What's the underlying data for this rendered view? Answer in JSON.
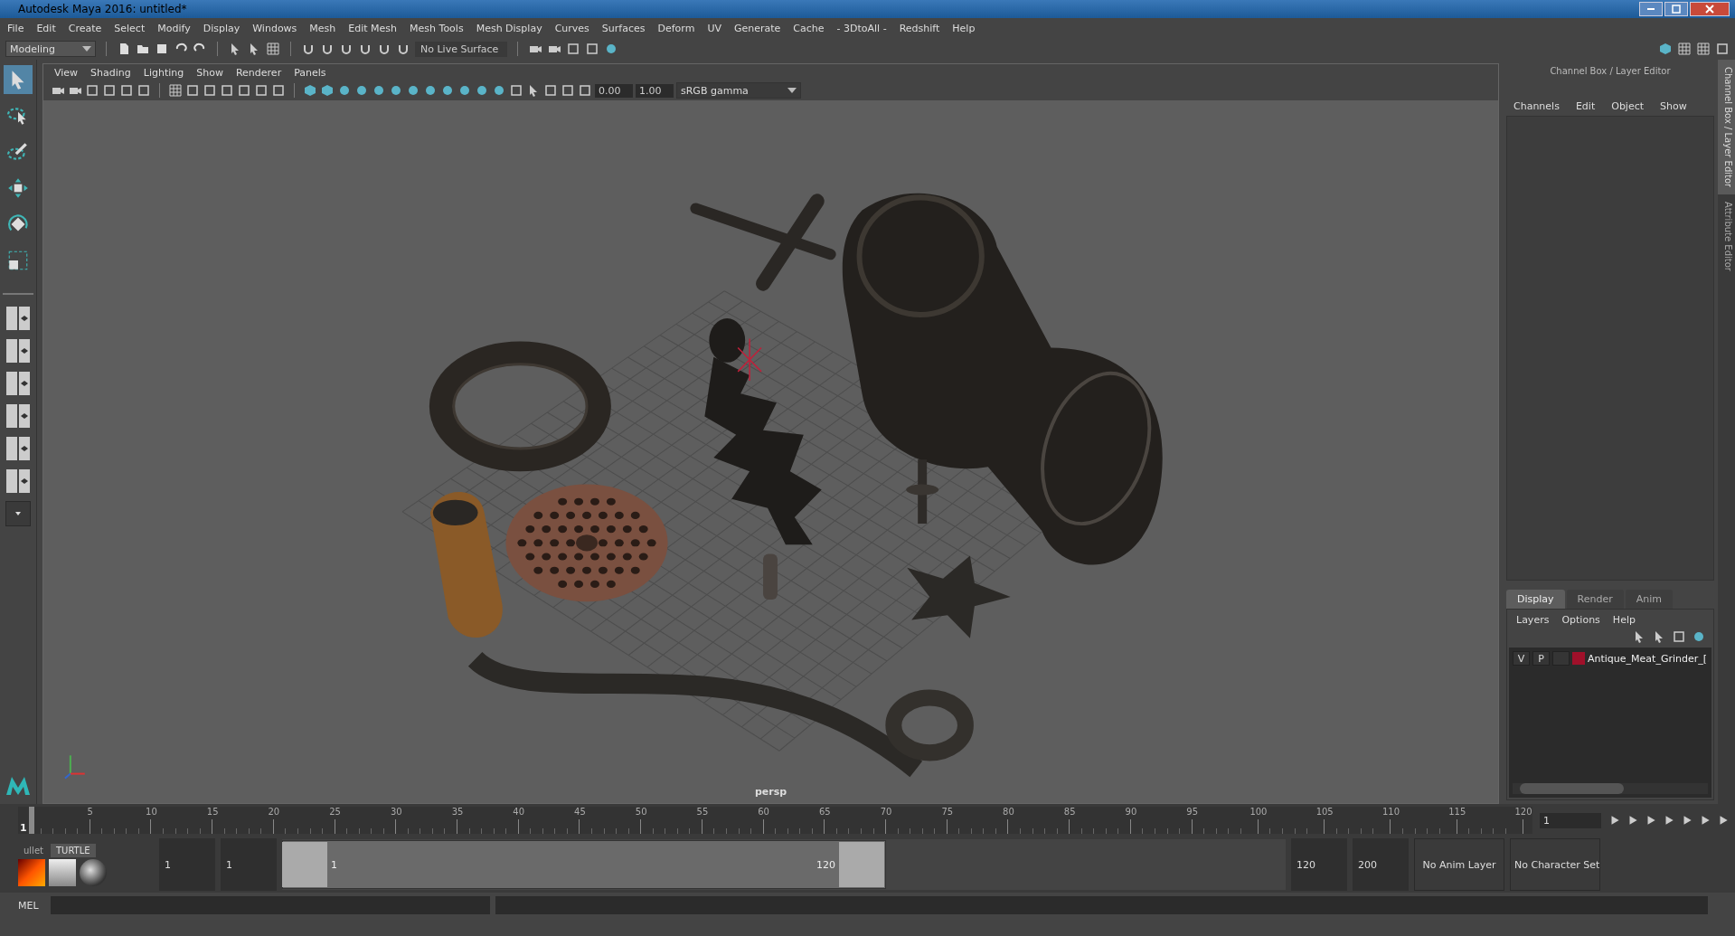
{
  "window": {
    "title": "Autodesk Maya 2016: untitled*"
  },
  "menu_bar": [
    "File",
    "Edit",
    "Create",
    "Select",
    "Modify",
    "Display",
    "Windows",
    "Mesh",
    "Edit Mesh",
    "Mesh Tools",
    "Mesh Display",
    "Curves",
    "Surfaces",
    "Deform",
    "UV",
    "Generate",
    "Cache",
    "- 3DtoAll -",
    "Redshift",
    "Help"
  ],
  "status_line": {
    "mode": "Modeling",
    "live_surface": "No Live Surface"
  },
  "toolbox": [
    {
      "kind": "select",
      "selected": true
    },
    {
      "kind": "lasso",
      "selected": false
    },
    {
      "kind": "paint",
      "selected": false
    },
    {
      "kind": "move",
      "selected": false
    },
    {
      "kind": "rotate",
      "selected": false
    },
    {
      "kind": "scale",
      "selected": false
    }
  ],
  "viewport": {
    "menu": [
      "View",
      "Shading",
      "Lighting",
      "Show",
      "Renderer",
      "Panels"
    ],
    "exposure": "0.00",
    "gamma": "1.00",
    "color_space": "sRGB gamma",
    "camera": "persp"
  },
  "channel_box": {
    "title": "Channel Box / Layer Editor",
    "menu": [
      "Channels",
      "Edit",
      "Object",
      "Show"
    ]
  },
  "layer_editor": {
    "tabs": [
      {
        "label": "Display",
        "selected": true
      },
      {
        "label": "Render",
        "selected": false
      },
      {
        "label": "Anim",
        "selected": false
      }
    ],
    "menu": [
      "Layers",
      "Options",
      "Help"
    ],
    "layers": [
      {
        "visibility": "V",
        "playback": "P",
        "color": "#a0102a",
        "name": "Antique_Meat_Grinder_["
      }
    ]
  },
  "side_tabs": [
    "Channel Box / Layer Editor",
    "Attribute Editor"
  ],
  "time_slider": {
    "start_label": "1",
    "ticks": [
      "5",
      "10",
      "15",
      "20",
      "25",
      "30",
      "35",
      "40",
      "45",
      "50",
      "55",
      "60",
      "65",
      "70",
      "75",
      "80",
      "85",
      "90",
      "95",
      "100",
      "105",
      "110",
      "115",
      "120"
    ],
    "current_frame": "1",
    "level": 0.0
  },
  "shelf": {
    "tabs": [
      {
        "label": "ullet",
        "selected": false
      },
      {
        "label": "TURTLE",
        "selected": true
      }
    ]
  },
  "range_slider": {
    "level": 0.6,
    "start": "1",
    "playback_start": "1",
    "range_start": "1",
    "range_end": "120",
    "playback_end": "120",
    "end": "200",
    "anim_layer": "No Anim Layer",
    "character_set": "No Character Set"
  },
  "command_line": {
    "language": "MEL"
  }
}
